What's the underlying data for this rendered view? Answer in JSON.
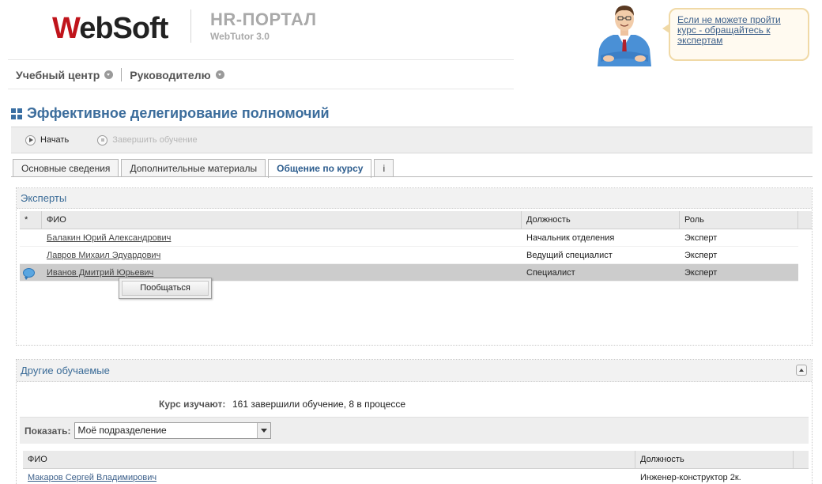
{
  "header": {
    "logo_w": "W",
    "logo_rest": "ebSoft",
    "portal_title": "HR-ПОРТАЛ",
    "portal_subtitle": "WebTutor 3.0",
    "help_text": "Если не можете пройти курс - обращайтесь к экспертам"
  },
  "menu": {
    "items": [
      {
        "label": "Учебный центр"
      },
      {
        "label": "Руководителю"
      }
    ]
  },
  "page": {
    "title": "Эффективное делегирование полномочий"
  },
  "toolbar": {
    "start_label": "Начать",
    "finish_label": "Завершить обучение"
  },
  "tabs": [
    {
      "label": "Основные сведения",
      "active": false
    },
    {
      "label": "Дополнительные материалы",
      "active": false
    },
    {
      "label": "Общение по курсу",
      "active": true
    },
    {
      "label": "i",
      "active": false
    }
  ],
  "experts": {
    "title": "Эксперты",
    "columns": {
      "star": "*",
      "name": "ФИО",
      "position": "Должность",
      "role": "Роль"
    },
    "rows": [
      {
        "name": "Балакин Юрий Александрович",
        "position": "Начальник отделения",
        "role": "Эксперт",
        "selected": false
      },
      {
        "name": "Лавров Михаил Эдуардович",
        "position": "Ведущий специалист",
        "role": "Эксперт",
        "selected": false
      },
      {
        "name": "Иванов Дмитрий Юрьевич",
        "position": "Специалист",
        "role": "Эксперт",
        "selected": true
      }
    ],
    "popup_label": "Пообщаться"
  },
  "others": {
    "title": "Другие обучаемые",
    "stats_label": "Курс изучают:",
    "stats_value": "161 завершили обучение, 8 в процессе",
    "filter_label": "Показать:",
    "filter_value": "Моё подразделение",
    "columns": {
      "name": "ФИО",
      "position": "Должность"
    },
    "rows": [
      {
        "name": "Макаров Сергей Владимирович",
        "position": "Инженер-конструктор 2к."
      }
    ]
  },
  "colors": {
    "accent": "#3c6d9c",
    "brand_red": "#c0141b",
    "selected_row": "#cccccc"
  }
}
